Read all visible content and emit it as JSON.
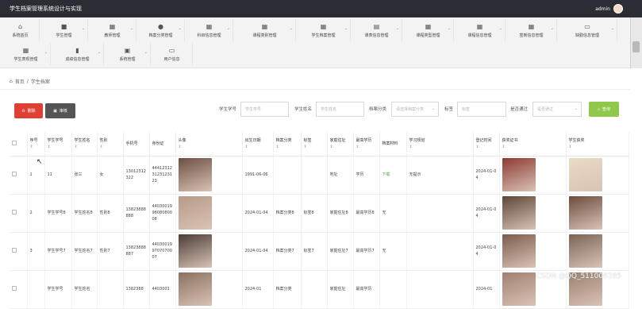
{
  "app": {
    "title": "学生档案管理系统设计与实现",
    "user": "admin"
  },
  "menu": [
    {
      "label": "系统首页",
      "icon": "home-icon"
    },
    {
      "label": "学生管理",
      "icon": "briefcase-icon"
    },
    {
      "label": "教师管理",
      "icon": "grid-icon"
    },
    {
      "label": "档案分类管理",
      "icon": "user-icon"
    },
    {
      "label": "科目信息管理",
      "icon": "grid-icon"
    },
    {
      "label": "课程类别管理",
      "icon": "grid-icon"
    },
    {
      "label": "学生档案管理",
      "icon": "grid-icon"
    },
    {
      "label": "课表信息管理",
      "icon": "file-icon"
    },
    {
      "label": "课程类型管理",
      "icon": "grid-icon"
    },
    {
      "label": "课程信息管理",
      "icon": "grid-icon"
    },
    {
      "label": "签到信息管理",
      "icon": "grid-icon"
    },
    {
      "label": "缺勤信息管理",
      "icon": "monitor-icon"
    },
    {
      "label": "学生表现管理",
      "icon": "grid-icon"
    },
    {
      "label": "成绩信息管理",
      "icon": "bar-chart-icon"
    },
    {
      "label": "系统管理",
      "icon": "clipboard-icon"
    },
    {
      "label": "用户信息",
      "icon": "window-icon"
    }
  ],
  "breadcrumb": {
    "home": "首页",
    "sep": "/",
    "current": "学生档案"
  },
  "toolbar": {
    "delete_label": "删除",
    "audit_label": "审核",
    "query_label": "查询"
  },
  "filters": {
    "student_no": {
      "label": "学生学号",
      "placeholder": "学生学号"
    },
    "student_name": {
      "label": "学生姓名",
      "placeholder": "学生姓名"
    },
    "category": {
      "label": "档案分类",
      "placeholder": "请选择档案分类"
    },
    "tag": {
      "label": "标签",
      "placeholder": "标签"
    },
    "approved": {
      "label": "是否通过",
      "placeholder": "是否通过"
    }
  },
  "table": {
    "headers": [
      "",
      "序号",
      "学生学号",
      "学生姓名",
      "性别",
      "手机号",
      "身份证",
      "头像",
      "出生日期",
      "档案分类",
      "标签",
      "家庭住址",
      "最高学历",
      "档案材料",
      "学习规划",
      "登记时间",
      "获奖证书",
      "学生获奖"
    ],
    "sortable": [
      false,
      true,
      true,
      true,
      true,
      false,
      false,
      true,
      true,
      true,
      true,
      true,
      true,
      false,
      true,
      true,
      true,
      true
    ],
    "rows": [
      {
        "idx": "1",
        "no": "11",
        "name": "张三",
        "gender": "女",
        "phone": "13012312322",
        "idcard": "444123123123123123",
        "birth": "1991-06-06",
        "category": "",
        "tag": "",
        "address": "地址",
        "edu": "学历",
        "material": "下载",
        "plan": "无提示",
        "reg": "2024-01-04"
      },
      {
        "idx": "2",
        "no": "学生学号8",
        "name": "学生姓名8",
        "gender": "性别8",
        "phone": "13823888888",
        "idcard": "440300199808080008",
        "birth": "2024-01-04",
        "category": "档案分类8",
        "tag": "标签8",
        "address": "家庭住址8",
        "edu": "最高学历8",
        "material": "无",
        "plan": "",
        "reg": "2024-01-04"
      },
      {
        "idx": "3",
        "no": "学生学号7",
        "name": "学生姓名7",
        "gender": "性别7",
        "phone": "13823888887",
        "idcard": "440300199707070007",
        "birth": "2024-01-04",
        "category": "档案分类7",
        "tag": "标签7",
        "address": "家庭住址7",
        "edu": "最高学历7",
        "material": "无",
        "plan": "",
        "reg": "2024-01-04"
      },
      {
        "idx": "",
        "no": "学生学号",
        "name": "学生姓名",
        "gender": "",
        "phone": "1382388",
        "idcard": "4403001",
        "birth": "2024-01",
        "category": "档案分类",
        "tag": "",
        "address": "家庭住址",
        "edu": "最高学历",
        "material": "",
        "plan": "",
        "reg": "2024-01"
      }
    ]
  },
  "watermark": "CSDN @QQ_511008285",
  "colors": {
    "topbar": "#2a2d33",
    "danger": "#e04033",
    "dark": "#555555",
    "success": "#8fc84a"
  }
}
